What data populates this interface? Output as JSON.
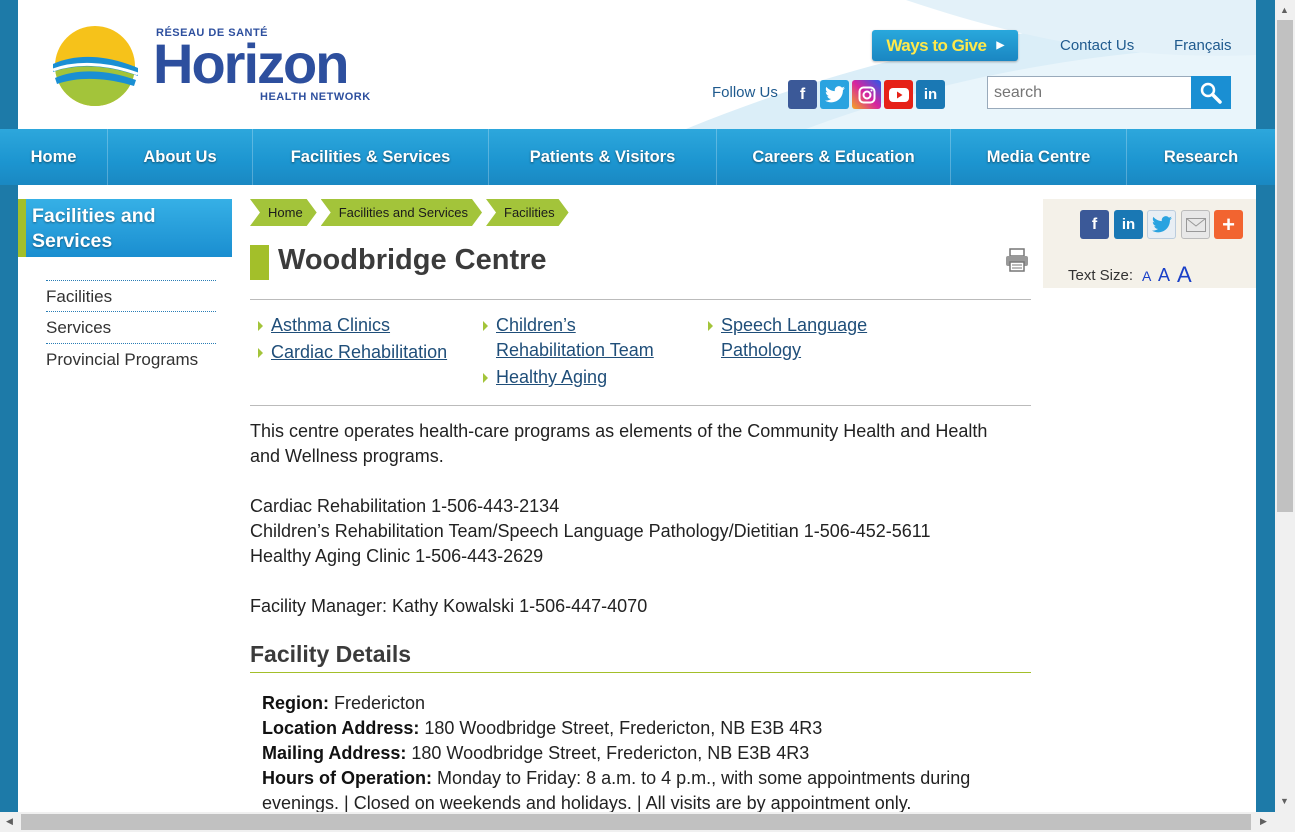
{
  "header": {
    "logo_small": "RÉSEAU DE SANTÉ",
    "logo_big": "Horizon",
    "logo_sub": "HEALTH NETWORK",
    "ways_to_give": "Ways to Give",
    "contact_us": "Contact Us",
    "francais": "Français",
    "follow_us": "Follow Us",
    "social_icons": [
      "facebook-icon",
      "twitter-icon",
      "instagram-icon",
      "youtube-icon",
      "linkedin-icon"
    ],
    "search_placeholder": "search"
  },
  "nav": {
    "items": [
      "Home",
      "About Us",
      "Facilities & Services",
      "Patients & Visitors",
      "Careers & Education",
      "Media Centre",
      "Research"
    ]
  },
  "sidebar": {
    "title": "Facilities and Services",
    "links": [
      "Facilities",
      "Services",
      "Provincial Programs"
    ]
  },
  "breadcrumb": [
    "Home",
    "Facilities and Services",
    "Facilities"
  ],
  "main": {
    "title": "Woodbridge Centre",
    "services": {
      "col1": [
        "Asthma Clinics",
        "Cardiac Rehabilitation"
      ],
      "col2a": "Children’s Rehabilitation Team",
      "col2b": "Healthy Aging",
      "col3": "Speech Language Pathology"
    },
    "intro": "This centre operates health-care programs as elements of the Community Health and Health and Wellness programs.",
    "phones": [
      "Cardiac Rehabilitation 1-506-443-2134",
      "Children’s Rehabilitation Team/Speech Language Pathology/Dietitian 1-506-452-5611",
      "Healthy Aging Clinic 1-506-443-2629"
    ],
    "manager": "Facility Manager: Kathy Kowalski 1-506-447-4070",
    "facility_details_title": "Facility Details",
    "details": {
      "region_label": "Region:",
      "region": "Fredericton",
      "location_label": "Location Address:",
      "location": "180 Woodbridge Street, Fredericton, NB E3B 4R3",
      "mailing_label": "Mailing Address:",
      "mailing": "180 Woodbridge Street, Fredericton, NB E3B 4R3",
      "hours_label": "Hours of Operation:",
      "hours_line1": "Monday to Friday: 8 a.m. to 4 p.m., with some appointments during",
      "hours_line2": "evenings. | Closed on weekends and holidays. | All visits are by appointment only."
    }
  },
  "share": {
    "icons": [
      "facebook-icon",
      "linkedin-icon",
      "twitter-icon",
      "email-icon",
      "plus-icon"
    ],
    "text_size_label": "Text Size:",
    "sizes": [
      "A",
      "A",
      "A"
    ]
  },
  "colors": {
    "brand_blue": "#1a8fd3",
    "accent_green": "#a3bf2a",
    "link": "#1f4e79"
  }
}
